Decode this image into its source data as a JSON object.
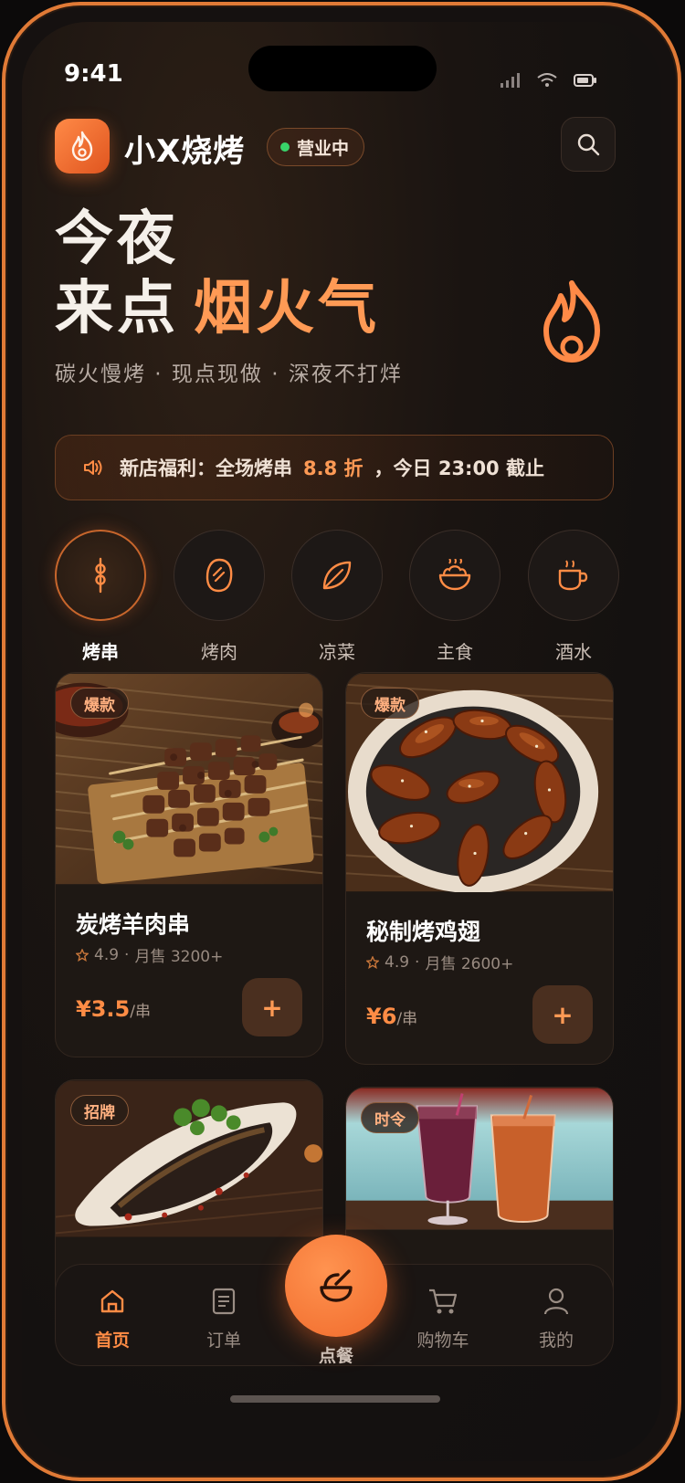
{
  "status": {
    "time": "9:41"
  },
  "header": {
    "brand": "小X烧烤",
    "open_status": "营业中"
  },
  "hero": {
    "line1": "今夜",
    "line2_prefix": "来点",
    "line2_accent": "烟火气",
    "subtitle": "碳火慢烤 · 现点现做 · 深夜不打烊"
  },
  "promo": {
    "prefix": "新店福利：全场烤串",
    "highlight": "8.8 折",
    "suffix": "，今日 23:00 截止"
  },
  "categories": [
    {
      "label": "烤串",
      "icon": "skewer-icon",
      "active": true
    },
    {
      "label": "烤肉",
      "icon": "meat-icon",
      "active": false
    },
    {
      "label": "凉菜",
      "icon": "leaf-icon",
      "active": false
    },
    {
      "label": "主食",
      "icon": "rice-bowl-icon",
      "active": false
    },
    {
      "label": "酒水",
      "icon": "cup-icon",
      "active": false
    }
  ],
  "products": [
    {
      "tag": "爆款",
      "name": "炭烤羊肉串",
      "rating": "4.9",
      "sales": "月售 3200+",
      "price": "¥3.5",
      "unit": "/串",
      "add": "+"
    },
    {
      "tag": "爆款",
      "name": "秘制烤鸡翅",
      "rating": "4.9",
      "sales": "月售 2600+",
      "price": "¥6",
      "unit": "/串",
      "add": "+"
    },
    {
      "tag": "招牌",
      "name": "",
      "rating": "",
      "sales": "",
      "price": "",
      "unit": ""
    },
    {
      "tag": "时令",
      "name": "",
      "rating": "",
      "sales": "",
      "price": "",
      "unit": ""
    }
  ],
  "tabbar": {
    "items": [
      {
        "label": "首页",
        "icon": "home-icon",
        "active": true
      },
      {
        "label": "订单",
        "icon": "orders-icon",
        "active": false
      },
      {
        "label": "点餐",
        "icon": "order-food-icon",
        "active": false
      },
      {
        "label": "购物车",
        "icon": "cart-icon",
        "active": false
      },
      {
        "label": "我的",
        "icon": "profile-icon",
        "active": false
      }
    ]
  },
  "colors": {
    "accent": "#ff8c45",
    "background": "#141110",
    "card": "#1e1814",
    "open_dot": "#39d36a"
  }
}
